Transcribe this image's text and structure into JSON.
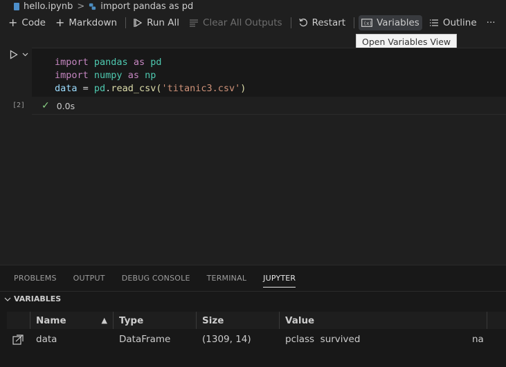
{
  "breadcrumb": {
    "file": "hello.ipynb",
    "separator": ">",
    "cell": "import pandas as pd"
  },
  "toolbar": {
    "code": "Code",
    "markdown": "Markdown",
    "run_all": "Run All",
    "clear_all": "Clear All Outputs",
    "restart": "Restart",
    "variables": "Variables",
    "outline": "Outline",
    "more": "···"
  },
  "tooltip": "Open Variables View",
  "cell": {
    "execution_count": "[2]",
    "status_time": "0.0s",
    "lines": [
      {
        "kw1": "import",
        "mod": "pandas",
        "kw2": "as",
        "alias": "pd"
      },
      {
        "kw1": "import",
        "mod": "numpy",
        "kw2": "as",
        "alias": "np"
      }
    ],
    "line3": {
      "var": "data",
      "eq": " = ",
      "obj": "pd",
      "dot": ".",
      "fn": "read_csv",
      "open": "(",
      "str": "'titanic3.csv'",
      "close": ")"
    }
  },
  "panel": {
    "tabs": [
      "PROBLEMS",
      "OUTPUT",
      "DEBUG CONSOLE",
      "TERMINAL",
      "JUPYTER"
    ],
    "active_tab": "JUPYTER",
    "section_title": "VARIABLES",
    "columns": [
      "Name",
      "Type",
      "Size",
      "Value"
    ],
    "rows": [
      {
        "name": "data",
        "type": "DataFrame",
        "size": "(1309, 14)",
        "value": "pclass  survived",
        "value_tail": "na"
      }
    ]
  },
  "colors": {
    "background": "#1f1f1f",
    "keyword": "#c586c0",
    "module": "#4ec9b0",
    "string": "#ce9178",
    "function": "#dcdcaa",
    "success": "#89d185"
  }
}
